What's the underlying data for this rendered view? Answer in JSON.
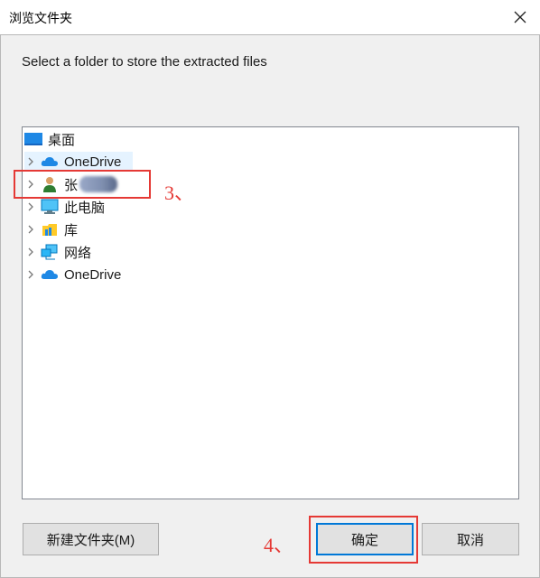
{
  "window": {
    "title": "浏览文件夹"
  },
  "instruction": "Select a folder to store the extracted files",
  "tree": {
    "items": [
      {
        "label": "桌面",
        "icon": "desktop-icon",
        "expandable": false
      },
      {
        "label": "OneDrive",
        "icon": "onedrive-cloud-icon",
        "expandable": true
      },
      {
        "label": "张",
        "icon": "user-icon",
        "expandable": true
      },
      {
        "label": "此电脑",
        "icon": "computer-icon",
        "expandable": true
      },
      {
        "label": "库",
        "icon": "library-icon",
        "expandable": true
      },
      {
        "label": "网络",
        "icon": "network-icon",
        "expandable": true
      },
      {
        "label": "OneDrive",
        "icon": "onedrive-cloud-icon",
        "expandable": true
      }
    ]
  },
  "annotations": {
    "step3": "3、",
    "step4": "4、"
  },
  "buttons": {
    "new_folder": "新建文件夹(M)",
    "ok": "确定",
    "cancel": "取消"
  },
  "colors": {
    "annotation": "#e53935",
    "accent": "#0078d7",
    "selection": "#e5f3ff"
  }
}
